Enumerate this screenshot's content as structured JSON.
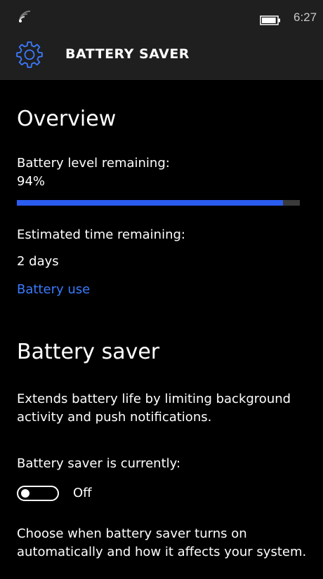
{
  "status_bar": {
    "time": "6:27",
    "battery_percent": 94
  },
  "header": {
    "title": "BATTERY SAVER"
  },
  "overview": {
    "title": "Overview",
    "battery_level_label": "Battery level remaining:",
    "battery_level_value": "94%",
    "battery_fraction": 0.94,
    "estimated_label": "Estimated time remaining:",
    "estimated_value": "2 days",
    "battery_use_link": "Battery use"
  },
  "battery_saver": {
    "title": "Battery saver",
    "description": "Extends battery life by limiting background activity and push notifications.",
    "currently_label": "Battery saver is currently:",
    "toggle_state": "Off",
    "choose_text": "Choose when battery saver turns on automatically and how it affects your system."
  },
  "colors": {
    "accent": "#3a7bff",
    "progress": "#2a5cf0",
    "background": "#000000",
    "header_background": "#1f1f1f"
  },
  "icons": {
    "signal": "signal-icon",
    "battery": "battery-icon",
    "settings": "gear-icon"
  }
}
